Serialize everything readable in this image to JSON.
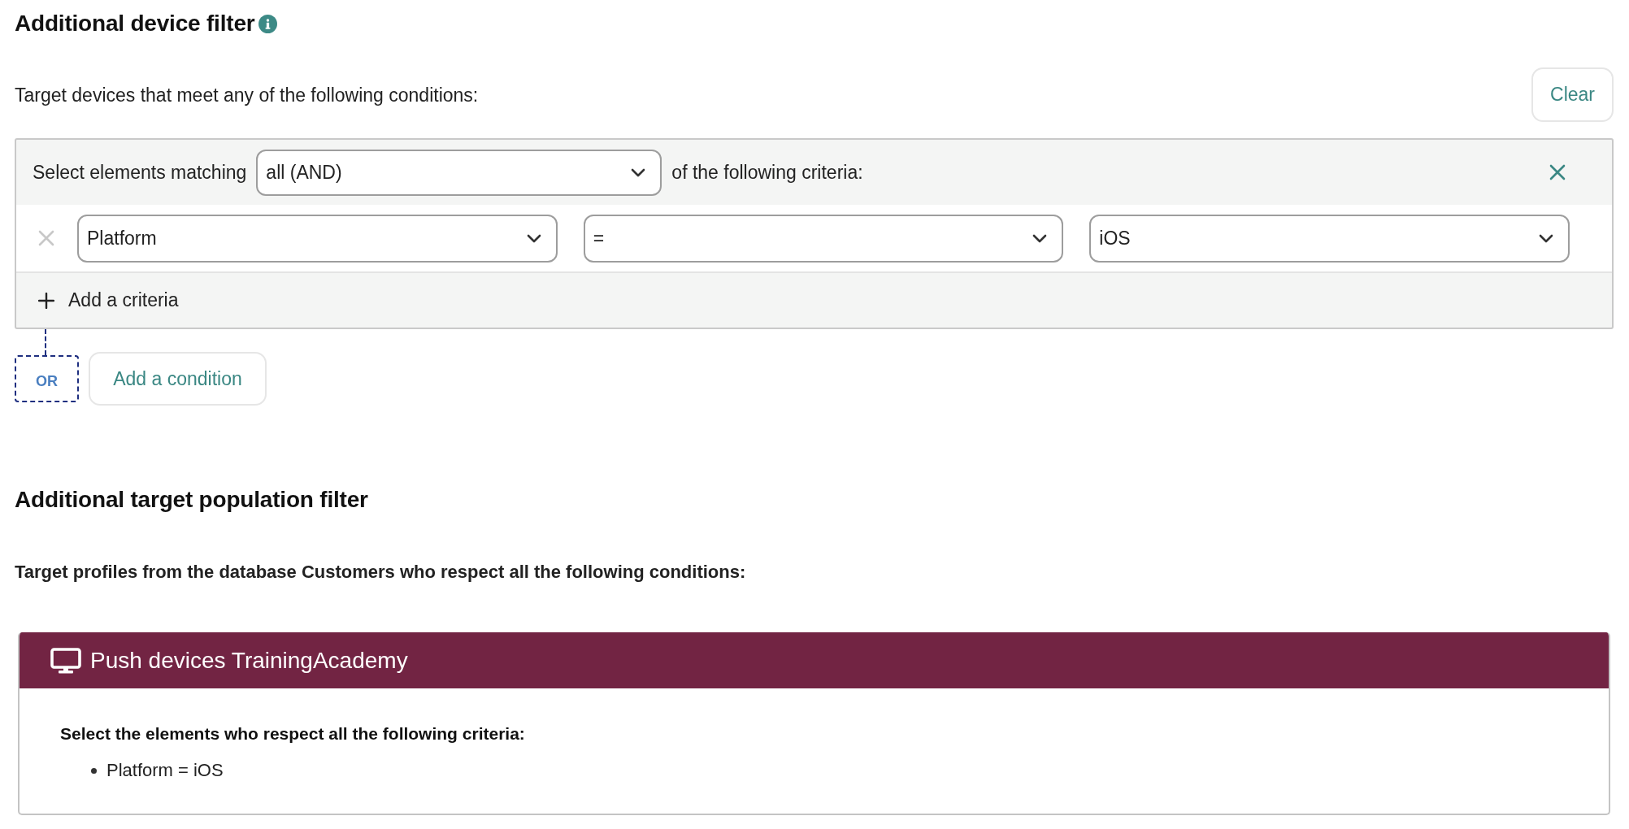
{
  "device_filter": {
    "title": "Additional device filter",
    "description": "Target devices that meet any of the following conditions:",
    "clear_button": "Clear",
    "conditions": [
      {
        "prefix": "Select elements matching",
        "match": "all (AND)",
        "suffix": "of the following criteria:",
        "criteria": [
          {
            "field": "Platform",
            "operator": "=",
            "value": "iOS",
            "remove_disabled": true
          }
        ],
        "add_criteria": "Add a criteria"
      }
    ],
    "connector": "OR",
    "add_condition": "Add a condition"
  },
  "population_filter": {
    "title": "Additional target population filter",
    "description": "Target profiles from the database Customers who respect all the following conditions:",
    "cards": [
      {
        "title": "Push devices TrainingAcademy",
        "intro": "Select the elements who respect all the following criteria:",
        "items": [
          "Platform = iOS"
        ]
      }
    ]
  }
}
